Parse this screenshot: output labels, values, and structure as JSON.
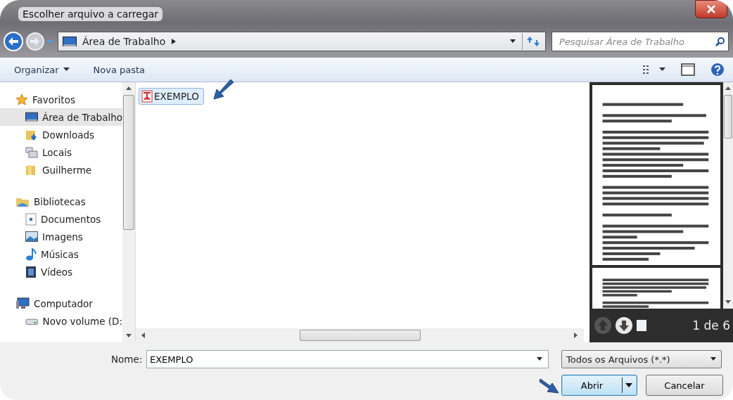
{
  "window": {
    "title": "Escolher arquivo a carregar"
  },
  "address_bar": {
    "location": "Área de Trabalho"
  },
  "search": {
    "placeholder": "Pesquisar Área de Trabalho"
  },
  "toolbar": {
    "items": [
      "Organizar",
      "Nova pasta"
    ]
  },
  "sidebar": {
    "groups": [
      {
        "label": "Favoritos",
        "kind": "star",
        "children": [
          {
            "label": "Área de Trabalho",
            "kind": "desktop",
            "selected": true
          },
          {
            "label": "Downloads",
            "kind": "download",
            "selected": false
          },
          {
            "label": "Locais",
            "kind": "places",
            "selected": false
          },
          {
            "label": "Guilherme",
            "kind": "folder",
            "selected": false
          }
        ]
      },
      {
        "label": "Bibliotecas",
        "kind": "library",
        "children": [
          {
            "label": "Documentos",
            "kind": "document",
            "selected": false
          },
          {
            "label": "Imagens",
            "kind": "image",
            "selected": false
          },
          {
            "label": "Músicas",
            "kind": "music",
            "selected": false
          },
          {
            "label": "Vídeos",
            "kind": "video",
            "selected": false
          }
        ]
      },
      {
        "label": "Computador",
        "kind": "computer",
        "children": [
          {
            "label": "Novo volume (D:",
            "kind": "drive",
            "selected": false
          }
        ]
      }
    ]
  },
  "files": [
    {
      "name": "EXEMPLO",
      "selected": true
    }
  ],
  "preview": {
    "page_counter": "1 de 6"
  },
  "footer": {
    "filename_label": "Nome:",
    "filename": "EXEMPLO",
    "filetype": "Todos os Arquivos (*.*)",
    "buttons": [
      {
        "label": "Abrir",
        "kind": "split"
      },
      {
        "label": "Cancelar",
        "kind": "plain"
      }
    ]
  }
}
